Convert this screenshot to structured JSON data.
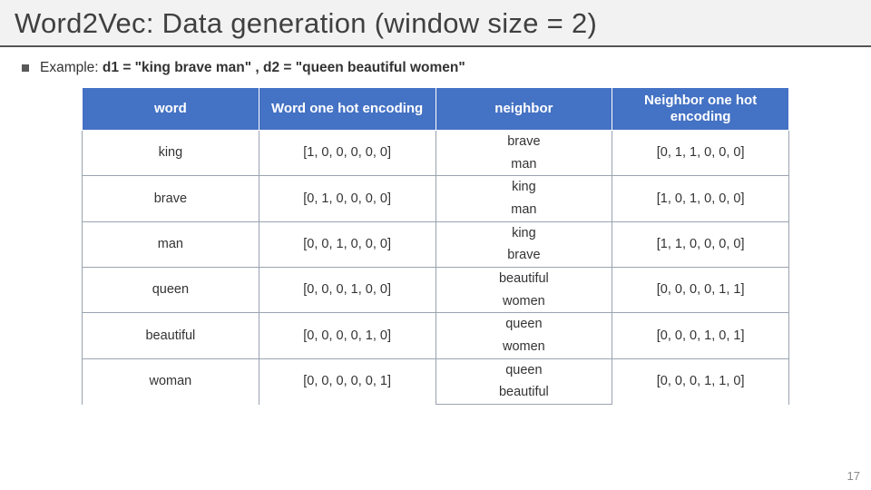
{
  "title": "Word2Vec: Data generation (window size = 2)",
  "example": {
    "prefix": "Example: ",
    "text": "d1 = \"king brave man\" , d2 = \"queen beautiful women\""
  },
  "headers": {
    "word": "word",
    "word_enc": "Word one hot encoding",
    "neighbor": "neighbor",
    "neighbor_enc": "Neighbor one hot encoding"
  },
  "rows": [
    {
      "word": "king",
      "enc": "[1, 0, 0, 0, 0, 0]",
      "n1": "brave",
      "n2": "man",
      "nenc": "[0, 1, 1, 0, 0, 0]"
    },
    {
      "word": "brave",
      "enc": "[0, 1, 0, 0, 0, 0]",
      "n1": "king",
      "n2": "man",
      "nenc": "[1, 0, 1, 0, 0, 0]"
    },
    {
      "word": "man",
      "enc": "[0, 0, 1, 0, 0, 0]",
      "n1": "king",
      "n2": "brave",
      "nenc": "[1, 1, 0, 0, 0, 0]"
    },
    {
      "word": "queen",
      "enc": "[0, 0, 0, 1, 0, 0]",
      "n1": "beautiful",
      "n2": "women",
      "nenc": "[0, 0, 0, 0, 1, 1]"
    },
    {
      "word": "beautiful",
      "enc": "[0, 0, 0, 0, 1, 0]",
      "n1": "queen",
      "n2": "women",
      "nenc": "[0, 0, 0, 1, 0, 1]"
    },
    {
      "word": "woman",
      "enc": "[0, 0, 0, 0, 0, 1]",
      "n1": "queen",
      "n2": "beautiful",
      "nenc": "[0, 0, 0, 1, 1, 0]"
    }
  ],
  "slide_number": "17",
  "chart_data": {
    "type": "table",
    "title": "Word2Vec data generation (window size = 2)",
    "columns": [
      "word",
      "Word one hot encoding",
      "neighbor",
      "Neighbor one hot encoding"
    ],
    "data": [
      [
        "king",
        "[1, 0, 0, 0, 0, 0]",
        "brave; man",
        "[0, 1, 1, 0, 0, 0]"
      ],
      [
        "brave",
        "[0, 1, 0, 0, 0, 0]",
        "king; man",
        "[1, 0, 1, 0, 0, 0]"
      ],
      [
        "man",
        "[0, 0, 1, 0, 0, 0]",
        "king; brave",
        "[1, 1, 0, 0, 0, 0]"
      ],
      [
        "queen",
        "[0, 0, 0, 1, 0, 0]",
        "beautiful; women",
        "[0, 0, 0, 0, 1, 1]"
      ],
      [
        "beautiful",
        "[0, 0, 0, 0, 1, 0]",
        "queen; women",
        "[0, 0, 0, 1, 0, 1]"
      ],
      [
        "woman",
        "[0, 0, 0, 0, 0, 1]",
        "queen; beautiful",
        "[0, 0, 0, 1, 1, 0]"
      ]
    ]
  }
}
